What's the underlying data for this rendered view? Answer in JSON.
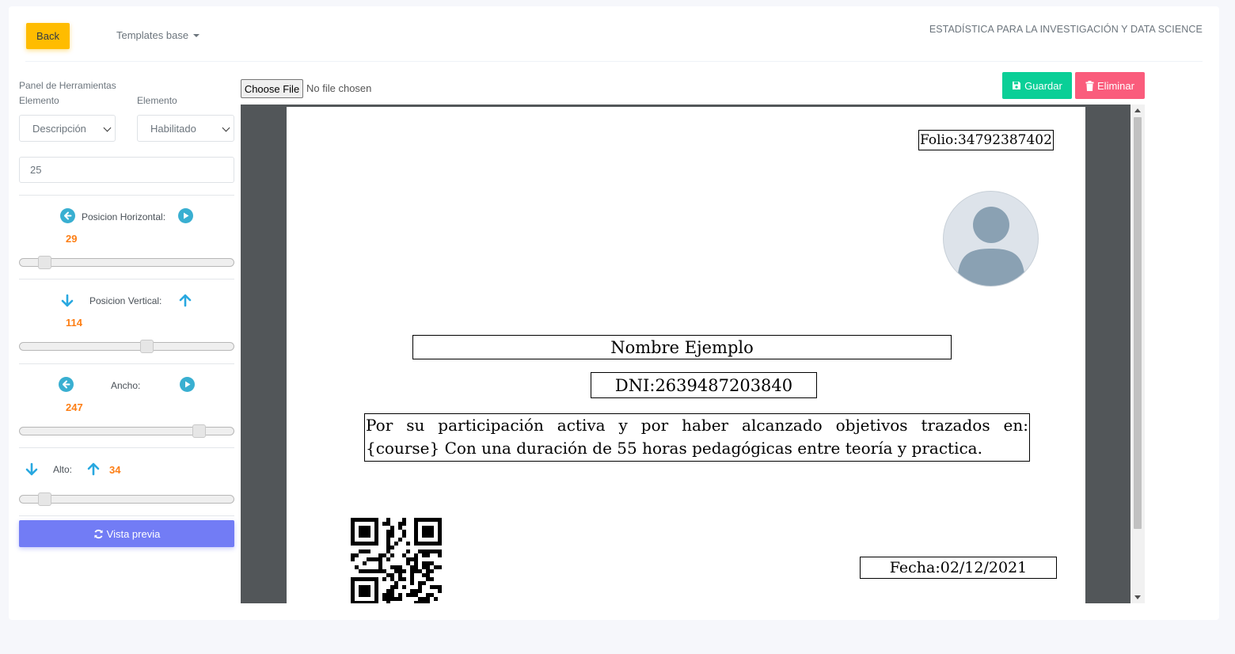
{
  "header": {
    "back_label": "Back",
    "templates_label": "Templates base",
    "brand": "ESTADÍSTICA PARA LA INVESTIGACIÓN Y DATA SCIENCE"
  },
  "panel": {
    "title": "Panel de Herramientas",
    "element_label_1": "Elemento",
    "element_label_2": "Elemento",
    "element_select_value": "Descripción",
    "state_select_value": "Habilitado",
    "size_input_value": "25",
    "horizontal": {
      "label": "Posicion Horizontal:",
      "value": "29",
      "level": 0.09
    },
    "vertical": {
      "label": "Posicion Vertical:",
      "value": "114",
      "level": 0.6
    },
    "width": {
      "label": "Ancho:",
      "value": "247",
      "level": 0.86
    },
    "height": {
      "label": "Alto:",
      "value": "34",
      "level": 0.09
    },
    "preview_label": "Vista previa"
  },
  "file": {
    "choose_label": "Choose File",
    "status": "No file chosen"
  },
  "actions": {
    "save_label": "Guardar",
    "delete_label": "Eliminar"
  },
  "certificate": {
    "folio": "Folio:34792387402",
    "name": "Nombre Ejemplo",
    "dni": "DNI:2639487203840",
    "description_line1": "Por su participación activa y por haber alcanzado objetivos trazados en:",
    "description_line2": "{course} Con una duración de 55 horas pedagógicas entre teoría y practica.",
    "date": "Fecha:02/12/2021"
  },
  "colors": {
    "back": "#ffbc00",
    "save": "#0acf97",
    "delete": "#fa5c7c",
    "preview": "#727cf5",
    "value_orange": "#fd7e14",
    "arrow_blue": "#39afd1"
  }
}
